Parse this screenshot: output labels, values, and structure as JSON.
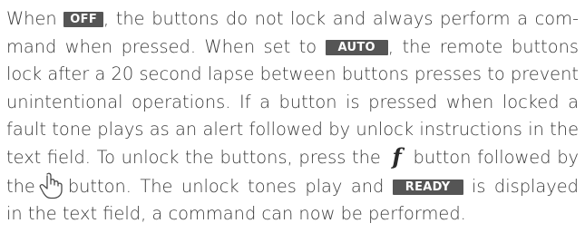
{
  "paragraph": {
    "l1a": "When",
    "tag_off": "OFF",
    "l1b": ", the buttons do not lock and always perform a com-",
    "l2a": "mand when pressed. When set to",
    "tag_auto": "AUTO",
    "l2b": ", the remote buttons",
    "l3": "lock after a 20 second lapse between buttons presses to prevent",
    "l4": "unintentional operations. If a button is pressed when locked a",
    "l5": "fault tone plays as an alert followed by unlock instructions in the",
    "l6a": "text field. To unlock the buttons, press the",
    "f_symbol": "f",
    "l6b": "button followed by",
    "l7a": "the",
    "l7b": "button. The unlock tones play and",
    "tag_ready": "READY",
    "l7c": "is displayed",
    "l8": "in the text field, a command can now be performed."
  },
  "icons": {
    "hand": "hand-pointer-icon"
  }
}
